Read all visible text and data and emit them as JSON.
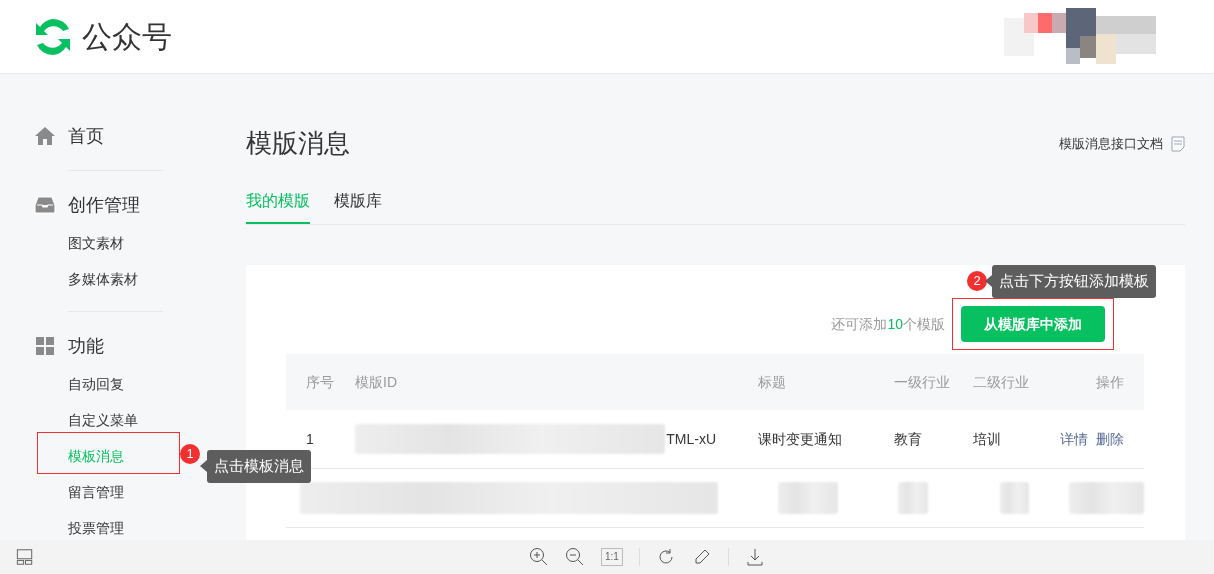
{
  "header": {
    "logo_text": "公众号"
  },
  "sidebar": [
    {
      "kind": "home",
      "label": "首页"
    },
    {
      "kind": "inbox",
      "label": "创作管理",
      "children": [
        {
          "label": "图文素材",
          "selected": false
        },
        {
          "label": "多媒体素材",
          "selected": false
        }
      ]
    },
    {
      "kind": "grid",
      "label": "功能",
      "children": [
        {
          "label": "自动回复",
          "selected": false
        },
        {
          "label": "自定义菜单",
          "selected": false
        },
        {
          "label": "模板消息",
          "selected": true
        },
        {
          "label": "留言管理",
          "selected": false
        },
        {
          "label": "投票管理",
          "selected": false
        }
      ]
    }
  ],
  "page": {
    "title": "模版消息",
    "doc_link": "模版消息接口文档",
    "tabs": [
      {
        "label": "我的模版",
        "selected": true
      },
      {
        "label": "模版库",
        "selected": false
      }
    ]
  },
  "quota": {
    "prefix": "还可添加",
    "count": "10",
    "suffix": "个模版"
  },
  "add_button": "从模版库中添加",
  "table": {
    "columns": [
      "序号",
      "模版ID",
      "标题",
      "一级行业",
      "二级行业",
      "操作"
    ],
    "rows": [
      {
        "kind": "normal",
        "cells": [
          "1",
          "TML-xU",
          "课时变更通知",
          "教育",
          "培训"
        ],
        "actions": [
          "详情",
          "删除"
        ]
      },
      {
        "kind": "blurred"
      }
    ]
  },
  "annotations": [
    {
      "number": "1",
      "text": "点击模板消息"
    },
    {
      "number": "2",
      "text": "点击下方按钮添加模板"
    }
  ],
  "toolbar": {
    "ratio_label": "1:1"
  }
}
